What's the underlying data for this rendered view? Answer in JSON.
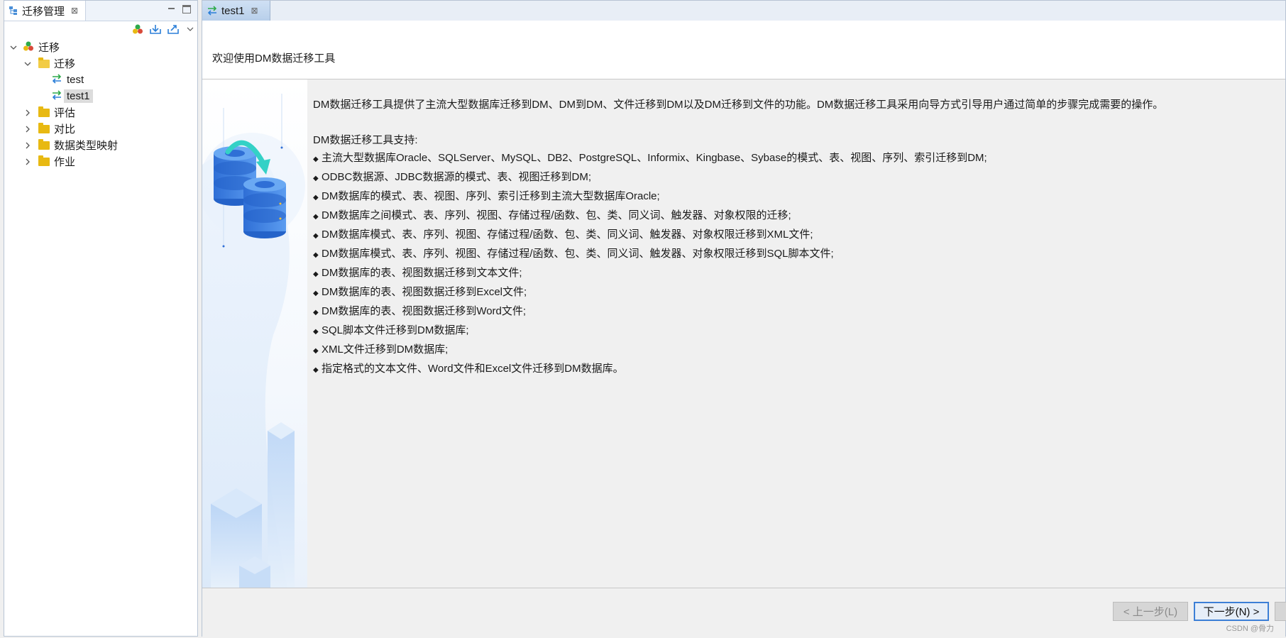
{
  "left_panel": {
    "tab_label": "迁移管理",
    "tab_close": "⊠",
    "tree": {
      "root": "迁移",
      "folder": "迁移",
      "items": [
        "test",
        "test1"
      ],
      "others": [
        "评估",
        "对比",
        "数据类型映射",
        "作业"
      ]
    }
  },
  "editor": {
    "tab_label": "test1",
    "tab_close": "⊠",
    "header_title": "欢迎使用DM数据迁移工具",
    "intro": "DM数据迁移工具提供了主流大型数据库迁移到DM、DM到DM、文件迁移到DM以及DM迁移到文件的功能。DM数据迁移工具采用向导方式引导用户通过简单的步骤完成需要的操作。",
    "support_title": "DM数据迁移工具支持:",
    "bullet_symbol": "◆",
    "bullets": [
      "主流大型数据库Oracle、SQLServer、MySQL、DB2、PostgreSQL、Informix、Kingbase、Sybase的模式、表、视图、序列、索引迁移到DM;",
      "ODBC数据源、JDBC数据源的模式、表、视图迁移到DM;",
      "DM数据库的模式、表、视图、序列、索引迁移到主流大型数据库Oracle;",
      "DM数据库之间模式、表、序列、视图、存储过程/函数、包、类、同义词、触发器、对象权限的迁移;",
      "DM数据库模式、表、序列、视图、存储过程/函数、包、类、同义词、触发器、对象权限迁移到XML文件;",
      "DM数据库模式、表、序列、视图、存储过程/函数、包、类、同义词、触发器、对象权限迁移到SQL脚本文件;",
      "DM数据库的表、视图数据迁移到文本文件;",
      "DM数据库的表、视图数据迁移到Excel文件;",
      "DM数据库的表、视图数据迁移到Word文件;",
      "SQL脚本文件迁移到DM数据库;",
      "XML文件迁移到DM数据库;",
      "指定格式的文本文件、Word文件和Excel文件迁移到DM数据库。"
    ],
    "back_button": "< 上一步(L)",
    "next_button": "下一步(N) >",
    "watermark": "CSDN @骨力"
  }
}
